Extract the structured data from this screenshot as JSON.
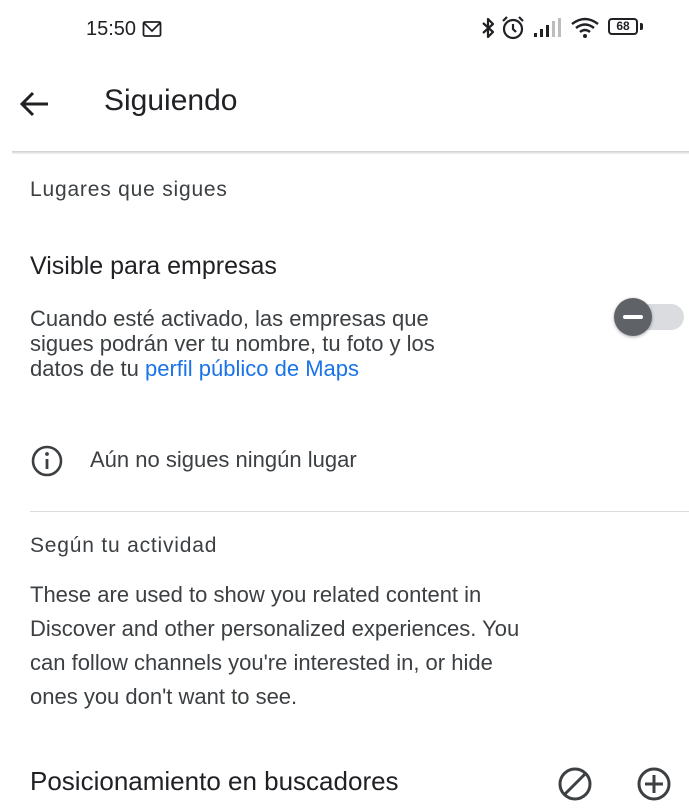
{
  "status_bar": {
    "time": "15:50",
    "battery": "68"
  },
  "app_bar": {
    "title": "Siguiendo"
  },
  "following_section": {
    "header": "Lugares que sigues",
    "visible_title": "Visible para empresas",
    "visible_desc_lines": [
      "Cuando esté activado, las empresas que",
      "sigues podrán ver tu nombre, tu foto y los",
      "datos de tu "
    ],
    "visible_desc_link": "perfil público de Maps",
    "toggle_on": false,
    "empty_message": "Aún no sigues ningún lugar"
  },
  "activity_section": {
    "header": "Según tu actividad",
    "description_lines": [
      "These are used to show you related content in",
      "Discover and other personalized experiences. You",
      "can follow channels you're interested in, or hide",
      "ones you don't want to see."
    ],
    "topic": "Posicionamiento en buscadores"
  },
  "colors": {
    "link": "#1a73e8",
    "text": "#202124",
    "secondary": "#3c4043",
    "toggle_thumb": "#5f6368",
    "toggle_track": "#dadce0"
  },
  "icons": [
    "mail-icon",
    "bluetooth-icon",
    "alarm-icon",
    "signal-icon",
    "wifi-icon",
    "battery-icon",
    "back-arrow-icon",
    "info-icon",
    "hide-icon",
    "follow-icon"
  ]
}
